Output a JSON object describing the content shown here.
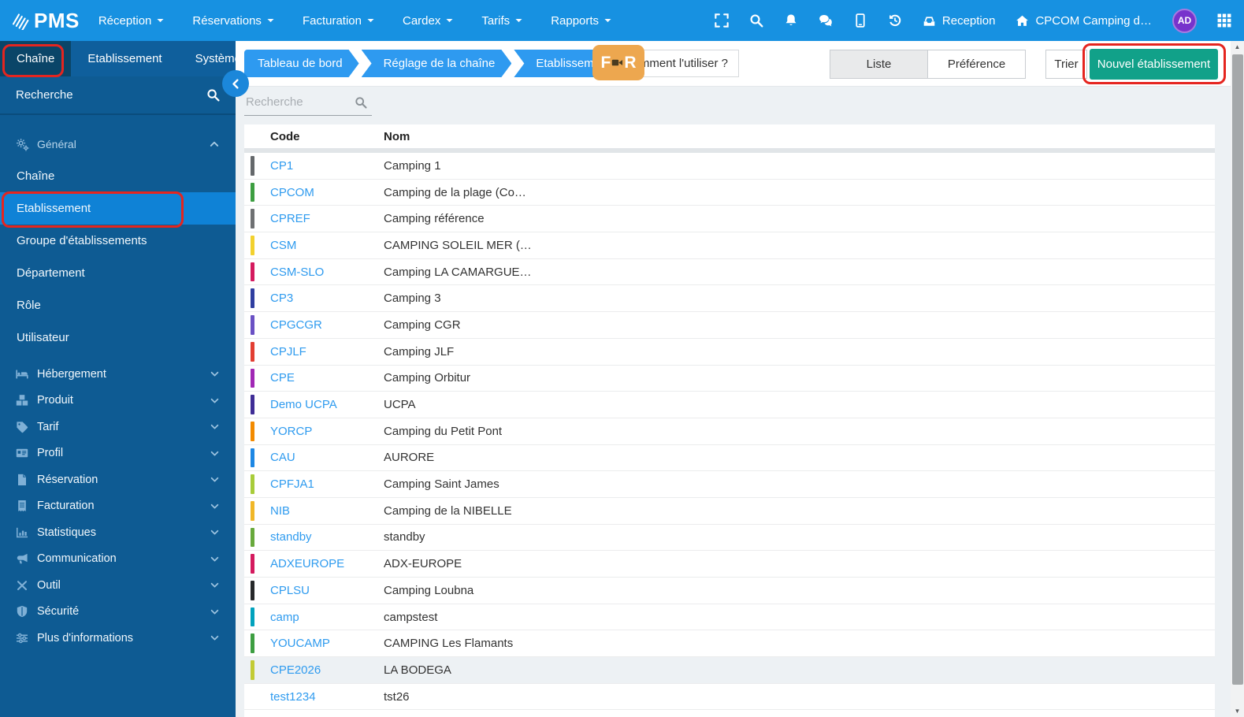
{
  "colors": {
    "navbar_blue": "#1791e1",
    "tabbar_blue": "#0f5f9c",
    "tab_active_blue": "#0a4568",
    "sidebar_blue": "#0e5b93",
    "sidebar_active_blue": "#0f82d6",
    "breadcrumb_blue": "#2e9af0",
    "new_button_green": "#11a189",
    "annotation_red": "#e5251f",
    "badge_orange": "#eda74f",
    "link_blue": "#2f9bef"
  },
  "navbar": {
    "logo_text": "PMS",
    "menus": [
      "Réception",
      "Réservations",
      "Facturation",
      "Cardex",
      "Tarifs",
      "Rapports"
    ],
    "icon_buttons": [
      "fullscreen",
      "search",
      "bell",
      "chat",
      "tablet",
      "history"
    ],
    "reception_label": "Reception",
    "property_label": "CPCOM Camping d…",
    "avatar_initials": "AD"
  },
  "module_tabs": [
    {
      "label": "Chaîne",
      "active": true
    },
    {
      "label": "Etablissement",
      "active": false
    },
    {
      "label": "Système",
      "active": false
    }
  ],
  "sidebar": {
    "search_label": "Recherche",
    "general": {
      "label": "Général",
      "items": [
        {
          "label": "Chaîne",
          "active": false
        },
        {
          "label": "Etablissement",
          "active": true
        },
        {
          "label": "Groupe d'établissements",
          "active": false
        },
        {
          "label": "Département",
          "active": false
        },
        {
          "label": "Rôle",
          "active": false
        },
        {
          "label": "Utilisateur",
          "active": false
        }
      ]
    },
    "sections": [
      {
        "icon": "bed",
        "label": "Hébergement"
      },
      {
        "icon": "boxes",
        "label": "Produit"
      },
      {
        "icon": "tags",
        "label": "Tarif"
      },
      {
        "icon": "id-card",
        "label": "Profil"
      },
      {
        "icon": "file",
        "label": "Réservation"
      },
      {
        "icon": "receipt",
        "label": "Facturation"
      },
      {
        "icon": "chart",
        "label": "Statistiques"
      },
      {
        "icon": "megaphone",
        "label": "Communication"
      },
      {
        "icon": "tools",
        "label": "Outil"
      },
      {
        "icon": "shield",
        "label": "Sécurité"
      },
      {
        "icon": "sliders",
        "label": "Plus d'informations"
      }
    ]
  },
  "breadcrumb": [
    "Tableau de bord",
    "Réglage de la chaîne",
    "Etablissement"
  ],
  "help": {
    "badge": "FR",
    "label": "Comment l'utiliser ?"
  },
  "toolbar": {
    "liste": "Liste",
    "preference": "Préférence",
    "trier": "Trier",
    "nouvel": "Nouvel établissement"
  },
  "list": {
    "search_placeholder": "Recherche",
    "columns": [
      "Code",
      "Nom"
    ],
    "rows": [
      {
        "code": "CP1",
        "name": "Camping 1",
        "color": "#64686b",
        "highlight": false
      },
      {
        "code": "CPCOM",
        "name": "Camping de la plage (Co…",
        "color": "#3d9e41",
        "highlight": false
      },
      {
        "code": "CPREF",
        "name": "Camping référence",
        "color": "#6e7072",
        "highlight": false
      },
      {
        "code": "CSM",
        "name": "CAMPING SOLEIL MER (…",
        "color": "#f2d12e",
        "highlight": false
      },
      {
        "code": "CSM-SLO",
        "name": "Camping LA CAMARGUE…",
        "color": "#d41a5e",
        "highlight": false
      },
      {
        "code": "CP3",
        "name": "Camping 3",
        "color": "#2f3ea0",
        "highlight": false
      },
      {
        "code": "CPGCGR",
        "name": "Camping CGR",
        "color": "#6a51c4",
        "highlight": false
      },
      {
        "code": "CPJLF",
        "name": "Camping JLF",
        "color": "#e23e32",
        "highlight": false
      },
      {
        "code": "CPE",
        "name": "Camping Orbitur",
        "color": "#a128b5",
        "highlight": false
      },
      {
        "code": "Demo UCPA",
        "name": "UCPA",
        "color": "#3f2d96",
        "highlight": false
      },
      {
        "code": "YORCP",
        "name": "Camping du Petit Pont",
        "color": "#f28a00",
        "highlight": false
      },
      {
        "code": "CAU",
        "name": "AURORE",
        "color": "#1d87e4",
        "highlight": false
      },
      {
        "code": "CPFJA1",
        "name": "Camping Saint James",
        "color": "#a8cc3a",
        "highlight": false
      },
      {
        "code": "NIB",
        "name": "Camping de la NIBELLE",
        "color": "#f0b728",
        "highlight": false
      },
      {
        "code": "standby",
        "name": "standby",
        "color": "#68a93c",
        "highlight": false
      },
      {
        "code": "ADXEUROPE",
        "name": "ADX-EUROPE",
        "color": "#d41a5e",
        "highlight": false
      },
      {
        "code": "CPLSU",
        "name": "Camping Loubna",
        "color": "#26282a",
        "highlight": false
      },
      {
        "code": "camp",
        "name": "campstest",
        "color": "#02a2bd",
        "highlight": false
      },
      {
        "code": "YOUCAMP",
        "name": "CAMPING Les Flamants",
        "color": "#3d9e41",
        "highlight": false
      },
      {
        "code": "CPE2026",
        "name": "LA BODEGA",
        "color": "#c2cb35",
        "highlight": true
      },
      {
        "code": "test1234",
        "name": "tst26",
        "color": null,
        "highlight": false
      }
    ]
  },
  "scrollbar": {
    "up_arrow": "▲",
    "down_arrow": "▼"
  }
}
